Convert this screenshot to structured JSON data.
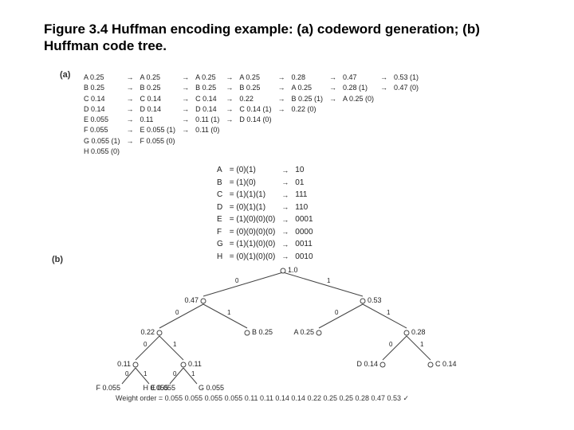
{
  "title": "Figure 3.4 Huffman encoding example: (a) codeword generation; (b) Huffman code tree.",
  "parts": {
    "a": "(a)",
    "b": "(b)"
  },
  "steps": {
    "col1": [
      "A 0.25",
      "B 0.25",
      "C 0.14",
      "D 0.14",
      "E 0.055",
      "F 0.055",
      "G 0.055 (1)",
      "H 0.055 (0)"
    ],
    "col2": [
      "A 0.25",
      "B 0.25",
      "C 0.14",
      "D 0.14",
      "0.11",
      "E 0.055 (1)",
      "F 0.055 (0)"
    ],
    "col3": [
      "A 0.25",
      "B 0.25",
      "C 0.14",
      "D 0.14",
      "0.11 (1)",
      "0.11 (0)"
    ],
    "col4": [
      "A 0.25",
      "B 0.25",
      "0.22",
      "C 0.14 (1)",
      "D 0.14 (0)"
    ],
    "col5": [
      "0.28",
      "A 0.25",
      "B 0.25 (1)",
      "0.22 (0)"
    ],
    "col6": [
      "0.47",
      "0.28 (1)",
      "A 0.25 (0)"
    ],
    "col7": [
      "0.53 (1)",
      "0.47 (0)"
    ]
  },
  "codes": [
    {
      "sym": "A",
      "paren": "= (0)(1)",
      "code": "10"
    },
    {
      "sym": "B",
      "paren": "= (1)(0)",
      "code": "01"
    },
    {
      "sym": "C",
      "paren": "= (1)(1)(1)",
      "code": "111"
    },
    {
      "sym": "D",
      "paren": "= (0)(1)(1)",
      "code": "110"
    },
    {
      "sym": "E",
      "paren": "= (1)(0)(0)(0)",
      "code": "0001"
    },
    {
      "sym": "F",
      "paren": "= (0)(0)(0)(0)",
      "code": "0000"
    },
    {
      "sym": "G",
      "paren": "= (1)(1)(0)(0)",
      "code": "0011"
    },
    {
      "sym": "H",
      "paren": "= (0)(1)(0)(0)",
      "code": "0010"
    }
  ],
  "tree": {
    "root": "1.0",
    "n47": "0.47",
    "n53": "0.53",
    "n22": "0.22",
    "b025": "B 0.25",
    "a025": "A 0.25",
    "n28": "0.28",
    "n11a": "0.11",
    "n11b": "0.11",
    "d014": "D 0.14",
    "c014": "C 0.14",
    "f": "F 0.055",
    "e": "E 0.055",
    "h": "H 0.055",
    "g": "G 0.055"
  },
  "weight_order": "Weight order = 0.055 0.055 0.055 0.055 0.11 0.11 0.14 0.14 0.22 0.25 0.25 0.28 0.47 0.53 ✓",
  "chart_data": {
    "type": "tree",
    "title": "Huffman code tree",
    "symbols": [
      {
        "sym": "A",
        "prob": 0.25,
        "code": "10"
      },
      {
        "sym": "B",
        "prob": 0.25,
        "code": "01"
      },
      {
        "sym": "C",
        "prob": 0.14,
        "code": "111"
      },
      {
        "sym": "D",
        "prob": 0.14,
        "code": "110"
      },
      {
        "sym": "E",
        "prob": 0.055,
        "code": "0001"
      },
      {
        "sym": "F",
        "prob": 0.055,
        "code": "0000"
      },
      {
        "sym": "G",
        "prob": 0.055,
        "code": "0011"
      },
      {
        "sym": "H",
        "prob": 0.055,
        "code": "0010"
      }
    ],
    "internal_nodes": [
      1.0,
      0.47,
      0.53,
      0.22,
      0.28,
      0.11,
      0.11
    ],
    "edges": [
      {
        "from": 1.0,
        "to": 0.47,
        "bit": 0
      },
      {
        "from": 1.0,
        "to": 0.53,
        "bit": 1
      },
      {
        "from": 0.47,
        "to": 0.22,
        "bit": 0
      },
      {
        "from": 0.47,
        "to": "B",
        "bit": 1
      },
      {
        "from": 0.53,
        "to": "A",
        "bit": 0
      },
      {
        "from": 0.53,
        "to": 0.28,
        "bit": 1
      },
      {
        "from": 0.22,
        "to": 0.11,
        "bit": 0
      },
      {
        "from": 0.22,
        "to": 0.11,
        "bit": 1
      },
      {
        "from": 0.28,
        "to": "D",
        "bit": 0
      },
      {
        "from": 0.28,
        "to": "C",
        "bit": 1
      },
      {
        "from": 0.11,
        "to": "F",
        "bit": 0
      },
      {
        "from": 0.11,
        "to": "E",
        "bit": 1
      },
      {
        "from": 0.11,
        "to": "H",
        "bit": 0
      },
      {
        "from": 0.11,
        "to": "G",
        "bit": 1
      }
    ]
  }
}
